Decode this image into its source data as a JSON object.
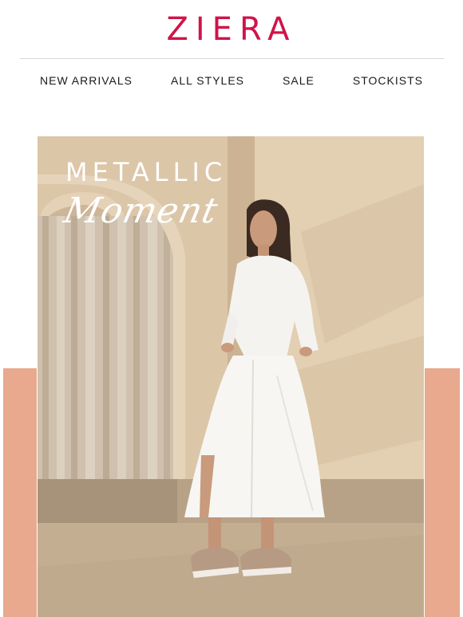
{
  "brand": {
    "logo_text": "ZIERA",
    "accent_color": "#d0134a"
  },
  "nav": {
    "items": [
      "NEW ARRIVALS",
      "ALL STYLES",
      "SALE",
      "STOCKISTS"
    ]
  },
  "hero": {
    "headline_line1": "METALLIC",
    "headline_line2": "Moment",
    "image_description_icon": "model-photo",
    "side_band_color": "#e8a98e"
  }
}
